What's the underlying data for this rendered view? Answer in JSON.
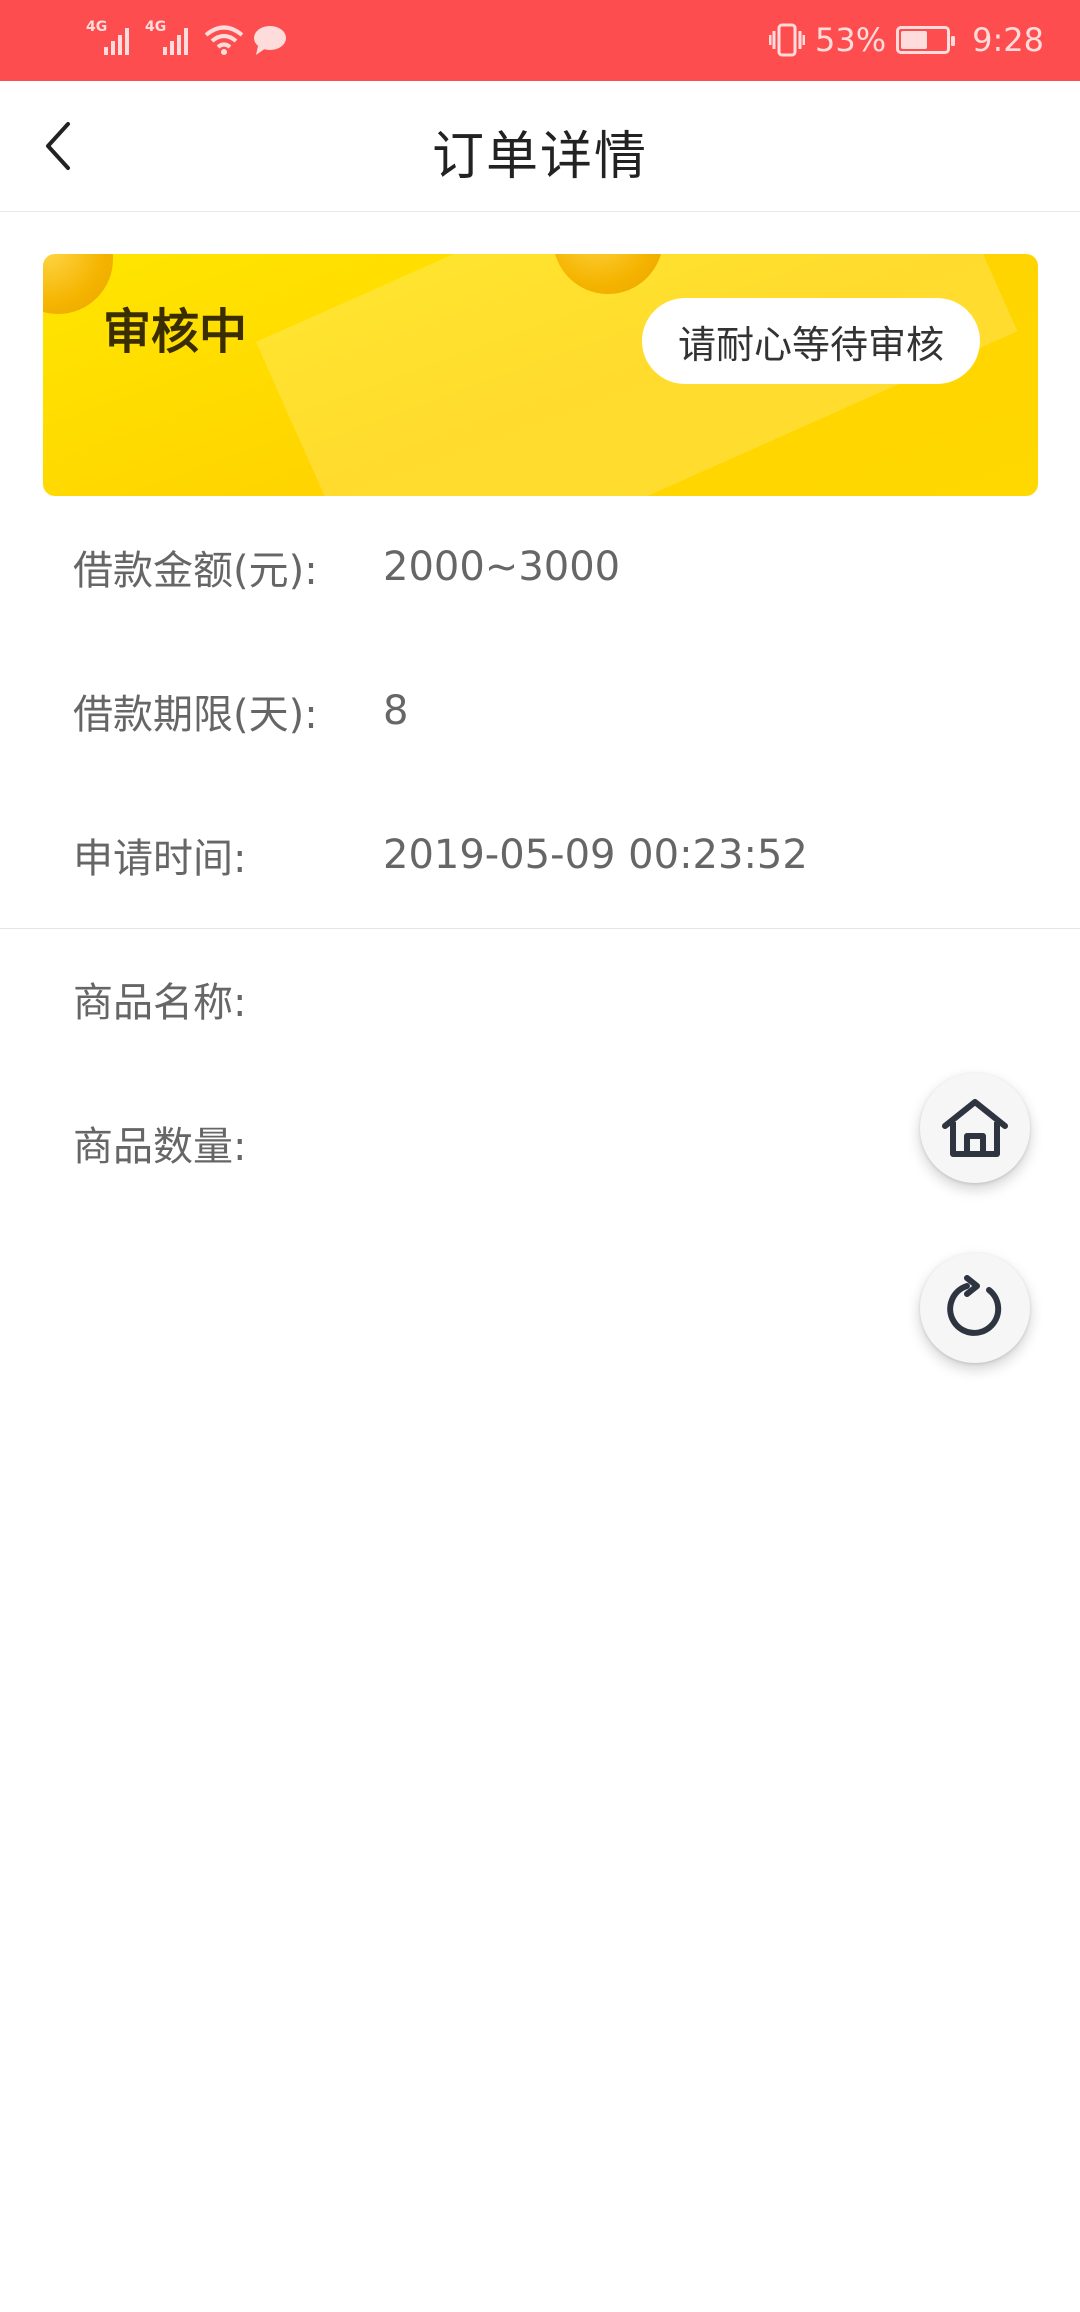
{
  "status_bar": {
    "network_1": "4G",
    "network_2": "4G",
    "battery": "53%",
    "battery_level": 0.53,
    "time": "9:28",
    "icons": [
      "signal-icon",
      "signal-icon",
      "wifi-icon",
      "message-icon",
      "vibrate-icon",
      "battery-icon"
    ]
  },
  "nav": {
    "title": "订单详情",
    "back_icon": "chevron-left-icon"
  },
  "status_card": {
    "title": "审核中",
    "button_label": "请耐心等待审核",
    "colors": {
      "card": "#ffdd00",
      "text": "#3a2e00"
    }
  },
  "order": {
    "amount_label": "借款金额(元):",
    "amount_value": "2000~3000",
    "term_label": "借款期限(天):",
    "term_value": "8",
    "apply_time_label": "申请时间:",
    "apply_time_value": "2019-05-09 00:23:52"
  },
  "product": {
    "name_label": "商品名称:",
    "name_value": "",
    "quantity_label": "商品数量:",
    "quantity_value": ""
  },
  "fabs": {
    "home_icon": "home-icon",
    "refresh_icon": "refresh-icon"
  },
  "colors": {
    "status_bar": "#fe4d4e",
    "label_text": "#666666"
  }
}
